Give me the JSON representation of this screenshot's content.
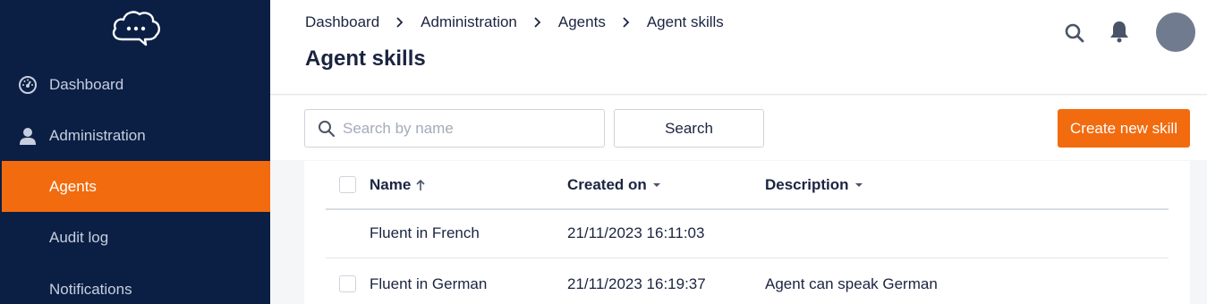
{
  "sidebar": {
    "logo_icon": "chat-cloud-icon",
    "items": [
      {
        "label": "Dashboard",
        "icon": "dashboard-gauge-icon"
      },
      {
        "label": "Administration",
        "icon": "user-icon"
      },
      {
        "label": "Agents",
        "active": true
      },
      {
        "label": "Audit log"
      },
      {
        "label": "Notifications"
      }
    ]
  },
  "header": {
    "breadcrumb": [
      "Dashboard",
      "Administration",
      "Agents",
      "Agent skills"
    ],
    "title": "Agent skills",
    "icons": [
      "search-icon",
      "bell-icon",
      "avatar"
    ]
  },
  "toolbar": {
    "search_placeholder": "Search by name",
    "search_value": "",
    "search_button": "Search",
    "create_button": "Create new skill"
  },
  "table": {
    "columns": [
      {
        "label": "Name",
        "sort": "ascending"
      },
      {
        "label": "Created on",
        "sort": "dropdown"
      },
      {
        "label": "Description",
        "sort": "dropdown"
      }
    ],
    "rows": [
      {
        "name": "Fluent in French",
        "created": "21/11/2023 16:11:03",
        "description": ""
      },
      {
        "name": "Fluent in German",
        "created": "21/11/2023 16:19:37",
        "description": "Agent can speak German"
      }
    ]
  },
  "colors": {
    "sidebar_bg": "#0b1f45",
    "accent": "#f26b0f",
    "text_dark": "#1b2440",
    "avatar": "#707b90"
  }
}
